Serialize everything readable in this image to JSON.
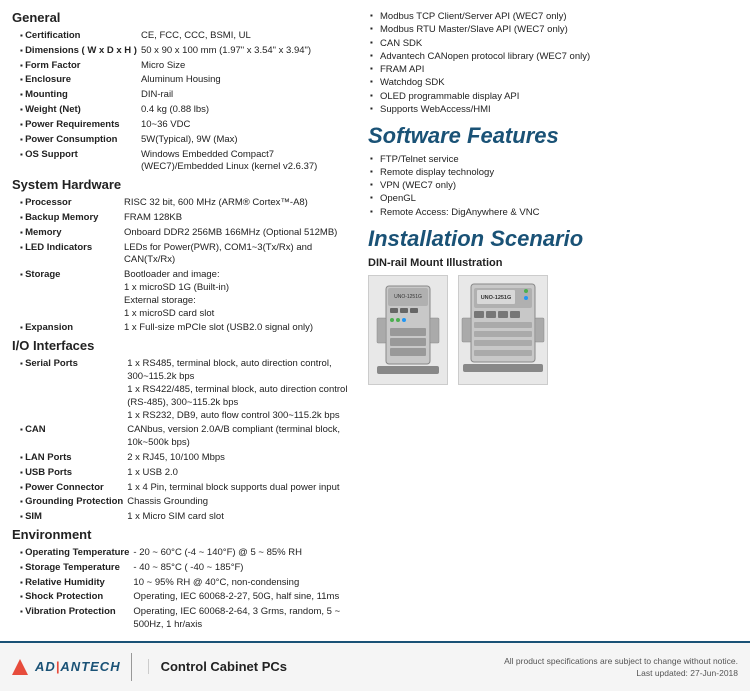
{
  "left": {
    "general": {
      "title": "General",
      "specs": [
        {
          "label": "Certification",
          "value": "CE, FCC, CCC, BSMI, UL"
        },
        {
          "label": "Dimensions ( W x D x H )",
          "value": "50 x 90 x 100 mm (1.97\" x 3.54\" x 3.94\")"
        },
        {
          "label": "Form Factor",
          "value": "Micro Size"
        },
        {
          "label": "Enclosure",
          "value": "Aluminum Housing"
        },
        {
          "label": "Mounting",
          "value": "DIN-rail"
        },
        {
          "label": "Weight (Net)",
          "value": "0.4 kg (0.88 lbs)"
        },
        {
          "label": "Power Requirements",
          "value": "10~36 VDC"
        },
        {
          "label": "Power Consumption",
          "value": "5W(Typical), 9W (Max)"
        },
        {
          "label": "OS Support",
          "value": "Windows Embedded Compact7 (WEC7)/Embedded Linux (kernel v2.6.37)"
        }
      ]
    },
    "system_hardware": {
      "title": "System Hardware",
      "specs": [
        {
          "label": "Processor",
          "value": "RISC 32 bit, 600 MHz (ARM® Cortex™-A8)"
        },
        {
          "label": "Backup Memory",
          "value": "FRAM 128KB"
        },
        {
          "label": "Memory",
          "value": "Onboard DDR2 256MB 166MHz (Optional 512MB)"
        },
        {
          "label": "LED Indicators",
          "value": "LEDs for Power(PWR), COM1~3(Tx/Rx) and CAN(Tx/Rx)"
        },
        {
          "label": "Storage",
          "value": "Bootloader and image:\n1 x microSD 1G (Built-in)\nExternal storage:\n1 x microSD card slot"
        },
        {
          "label": "Expansion",
          "value": "1 x Full-size mPCIe slot (USB2.0 signal only)"
        }
      ]
    },
    "io_interfaces": {
      "title": "I/O Interfaces",
      "specs": [
        {
          "label": "Serial Ports",
          "value": "1 x RS485, terminal block, auto direction control, 300~115.2k bps\n1 x RS422/485, terminal block, auto direction control (RS-485), 300~115.2k bps\n1 x RS232, DB9, auto flow control 300~115.2k bps"
        },
        {
          "label": "CAN",
          "value": "CANbus, version 2.0A/B compliant (terminal block, 10k~500k bps)"
        },
        {
          "label": "LAN Ports",
          "value": "2 x RJ45, 10/100 Mbps"
        },
        {
          "label": "USB Ports",
          "value": "1 x USB 2.0"
        },
        {
          "label": "Power Connector",
          "value": "1 x 4 Pin, terminal block supports dual power input"
        },
        {
          "label": "Grounding Protection",
          "value": "Chassis Grounding"
        },
        {
          "label": "SIM",
          "value": "1 x Micro SIM card slot"
        }
      ]
    },
    "environment": {
      "title": "Environment",
      "specs": [
        {
          "label": "Operating Temperature",
          "value": "- 20 ~ 60°C (-4 ~ 140°F) @ 5 ~ 85% RH"
        },
        {
          "label": "Storage Temperature",
          "value": "- 40 ~ 85°C ( -40 ~ 185°F)"
        },
        {
          "label": "Relative Humidity",
          "value": "10 ~ 95% RH @ 40°C, non-condensing"
        },
        {
          "label": "Shock Protection",
          "value": "Operating, IEC 60068-2-27, 50G, half sine, 11ms"
        },
        {
          "label": "Vibration Protection",
          "value": "Operating, IEC 60068-2-64, 3 Grms, random, 5 ~ 500Hz, 1 hr/axis"
        }
      ]
    }
  },
  "right": {
    "api_bullets": [
      "Modbus TCP Client/Server API (WEC7 only)",
      "Modbus RTU Master/Slave API (WEC7 only)",
      "CAN SDK",
      "Advantech CANopen protocol library (WEC7 only)",
      "FRAM API",
      "Watchdog SDK",
      "OLED programmable display API",
      "Supports WebAccess/HMI"
    ],
    "software_features": {
      "title": "Software Features",
      "bullets": [
        "FTP/Telnet service",
        "Remote display technology",
        "VPN (WEC7 only)",
        "OpenGL",
        "Remote Access: DigAnywhere & VNC"
      ]
    },
    "installation_scenario": {
      "title": "Installation Scenario",
      "sub_title": "DIN-rail Mount Illustration"
    }
  },
  "footer": {
    "logo_text": "AD\\ANTECH",
    "product_category": "Control Cabinet PCs",
    "notice": "All product specifications are subject to change without notice.",
    "last_updated": "Last updated: 27-Jun-2018"
  }
}
